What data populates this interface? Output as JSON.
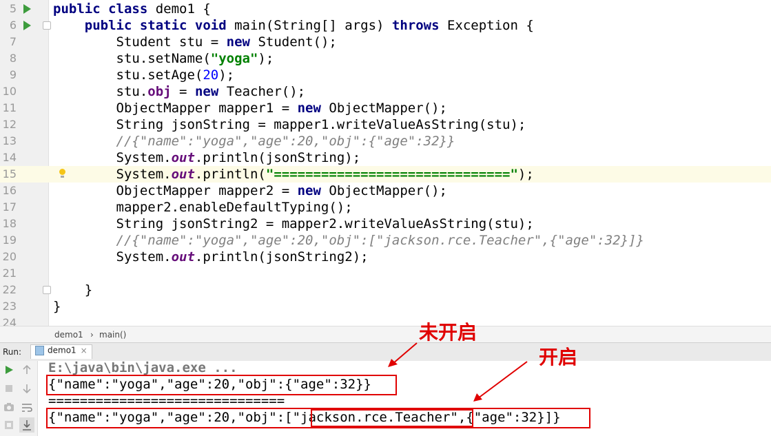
{
  "editor": {
    "lines": [
      {
        "num": "5",
        "code": [
          {
            "t": "public class",
            "c": "kw"
          },
          {
            "t": " demo1 {",
            "c": ""
          }
        ]
      },
      {
        "num": "6",
        "code": [
          {
            "t": "    ",
            "c": ""
          },
          {
            "t": "public static void",
            "c": "kw"
          },
          {
            "t": " main(String[] args) ",
            "c": ""
          },
          {
            "t": "throws",
            "c": "kw"
          },
          {
            "t": " Exception {",
            "c": ""
          }
        ]
      },
      {
        "num": "7",
        "code": [
          {
            "t": "        Student stu = ",
            "c": ""
          },
          {
            "t": "new",
            "c": "kw"
          },
          {
            "t": " Student();",
            "c": ""
          }
        ]
      },
      {
        "num": "8",
        "code": [
          {
            "t": "        stu.setName(",
            "c": ""
          },
          {
            "t": "\"yoga\"",
            "c": "str"
          },
          {
            "t": ");",
            "c": ""
          }
        ]
      },
      {
        "num": "9",
        "code": [
          {
            "t": "        stu.setAge(",
            "c": ""
          },
          {
            "t": "20",
            "c": "num"
          },
          {
            "t": ");",
            "c": ""
          }
        ]
      },
      {
        "num": "10",
        "code": [
          {
            "t": "        stu.",
            "c": ""
          },
          {
            "t": "obj",
            "c": "fld"
          },
          {
            "t": " = ",
            "c": ""
          },
          {
            "t": "new",
            "c": "kw"
          },
          {
            "t": " Teacher();",
            "c": ""
          }
        ]
      },
      {
        "num": "11",
        "code": [
          {
            "t": "        ObjectMapper mapper1 = ",
            "c": ""
          },
          {
            "t": "new",
            "c": "kw"
          },
          {
            "t": " ObjectMapper();",
            "c": ""
          }
        ]
      },
      {
        "num": "12",
        "code": [
          {
            "t": "        String jsonString = mapper1.writeValueAsString(stu);",
            "c": ""
          }
        ]
      },
      {
        "num": "13",
        "code": [
          {
            "t": "        ",
            "c": ""
          },
          {
            "t": "//{\"name\":\"yoga\",\"age\":20,\"obj\":{\"age\":32}}",
            "c": "cmt"
          }
        ]
      },
      {
        "num": "14",
        "code": [
          {
            "t": "        System.",
            "c": ""
          },
          {
            "t": "out",
            "c": "sfld"
          },
          {
            "t": ".println(jsonString);",
            "c": ""
          }
        ]
      },
      {
        "num": "15",
        "code": [
          {
            "t": "        System.",
            "c": ""
          },
          {
            "t": "out",
            "c": "sfld"
          },
          {
            "t": ".println(",
            "c": ""
          },
          {
            "t": "\"==============================\"",
            "c": "str"
          },
          {
            "t": ");",
            "c": ""
          }
        ]
      },
      {
        "num": "16",
        "code": [
          {
            "t": "        ObjectMapper mapper2 = ",
            "c": ""
          },
          {
            "t": "new",
            "c": "kw"
          },
          {
            "t": " ObjectMapper();",
            "c": ""
          }
        ]
      },
      {
        "num": "17",
        "code": [
          {
            "t": "        mapper2.enableDefaultTyping();",
            "c": ""
          }
        ]
      },
      {
        "num": "18",
        "code": [
          {
            "t": "        String jsonString2 = mapper2.writeValueAsString(stu);",
            "c": ""
          }
        ]
      },
      {
        "num": "19",
        "code": [
          {
            "t": "        ",
            "c": ""
          },
          {
            "t": "//{\"name\":\"yoga\",\"age\":20,\"obj\":[\"jackson.rce.Teacher\",{\"age\":32}]}",
            "c": "cmt"
          }
        ]
      },
      {
        "num": "20",
        "code": [
          {
            "t": "        System.",
            "c": ""
          },
          {
            "t": "out",
            "c": "sfld"
          },
          {
            "t": ".println(jsonString2);",
            "c": ""
          }
        ]
      },
      {
        "num": "21",
        "code": []
      },
      {
        "num": "22",
        "code": [
          {
            "t": "    }",
            "c": ""
          }
        ]
      },
      {
        "num": "23",
        "code": [
          {
            "t": "}",
            "c": ""
          }
        ]
      },
      {
        "num": "24",
        "code": []
      }
    ],
    "highlight_line": "15"
  },
  "breadcrumb": {
    "class_name": "demo1",
    "separator": "›",
    "method": "main()"
  },
  "run_bar": {
    "label": "Run:",
    "tab_label": "demo1",
    "tab_close": "×"
  },
  "console": {
    "command": "E:\\java\\bin\\java.exe ...",
    "output1": "{\"name\":\"yoga\",\"age\":20,\"obj\":{\"age\":32}}",
    "separator": "==============================",
    "output2_prefix": "{\"name\":\"yoga\",\"age\":20,\"obj\":[\"",
    "output2_class": "jackson.rce.Teacher",
    "output2_suffix": "\",{\"age\":32}]}"
  },
  "annotations": {
    "not_enabled": "未开启",
    "enabled": "开启"
  },
  "colors": {
    "annotation_red": "#e00000",
    "keyword": "#000080",
    "string": "#008000",
    "comment": "#808080",
    "run_green": "#3d9c3d"
  }
}
